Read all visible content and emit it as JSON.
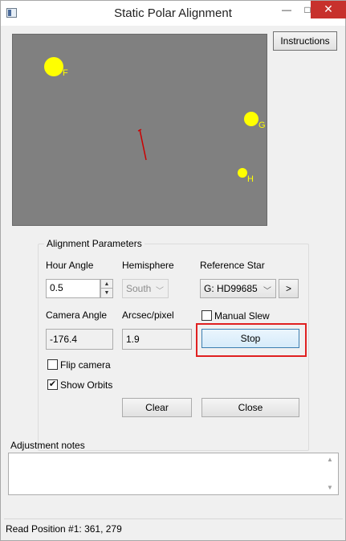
{
  "window": {
    "title": "Static Polar Alignment",
    "minimize_glyph": "—",
    "maximize_glyph": "□",
    "close_glyph": "✕"
  },
  "canvas": {
    "background": "#808080",
    "star_color": "#ffff00",
    "line_color": "#cc0000",
    "stars": [
      {
        "label": "F"
      },
      {
        "label": "G"
      },
      {
        "label": "H"
      }
    ]
  },
  "instructions_label": "Instructions",
  "alignment": {
    "group_title": "Alignment Parameters",
    "hour_angle_label": "Hour Angle",
    "hour_angle_value": "0.5",
    "hemisphere_label": "Hemisphere",
    "hemisphere_value": "South",
    "reference_star_label": "Reference Star",
    "reference_star_value": "G: HD99685",
    "next_star_label": ">",
    "camera_angle_label": "Camera Angle",
    "camera_angle_value": "-176.4",
    "arcsec_label": "Arcsec/pixel",
    "arcsec_value": "1.9",
    "manual_slew_label": "Manual Slew",
    "manual_slew_checked": false,
    "stop_label": "Stop",
    "flip_camera_label": "Flip camera",
    "flip_camera_checked": false,
    "show_orbits_label": "Show Orbits",
    "show_orbits_checked": true,
    "clear_label": "Clear",
    "close_label": "Close"
  },
  "notes": {
    "label": "Adjustment notes",
    "value": ""
  },
  "status": "Read Position #1: 361, 279",
  "colors": {
    "highlight": "#e02020",
    "accent": "#3c7fb1"
  }
}
